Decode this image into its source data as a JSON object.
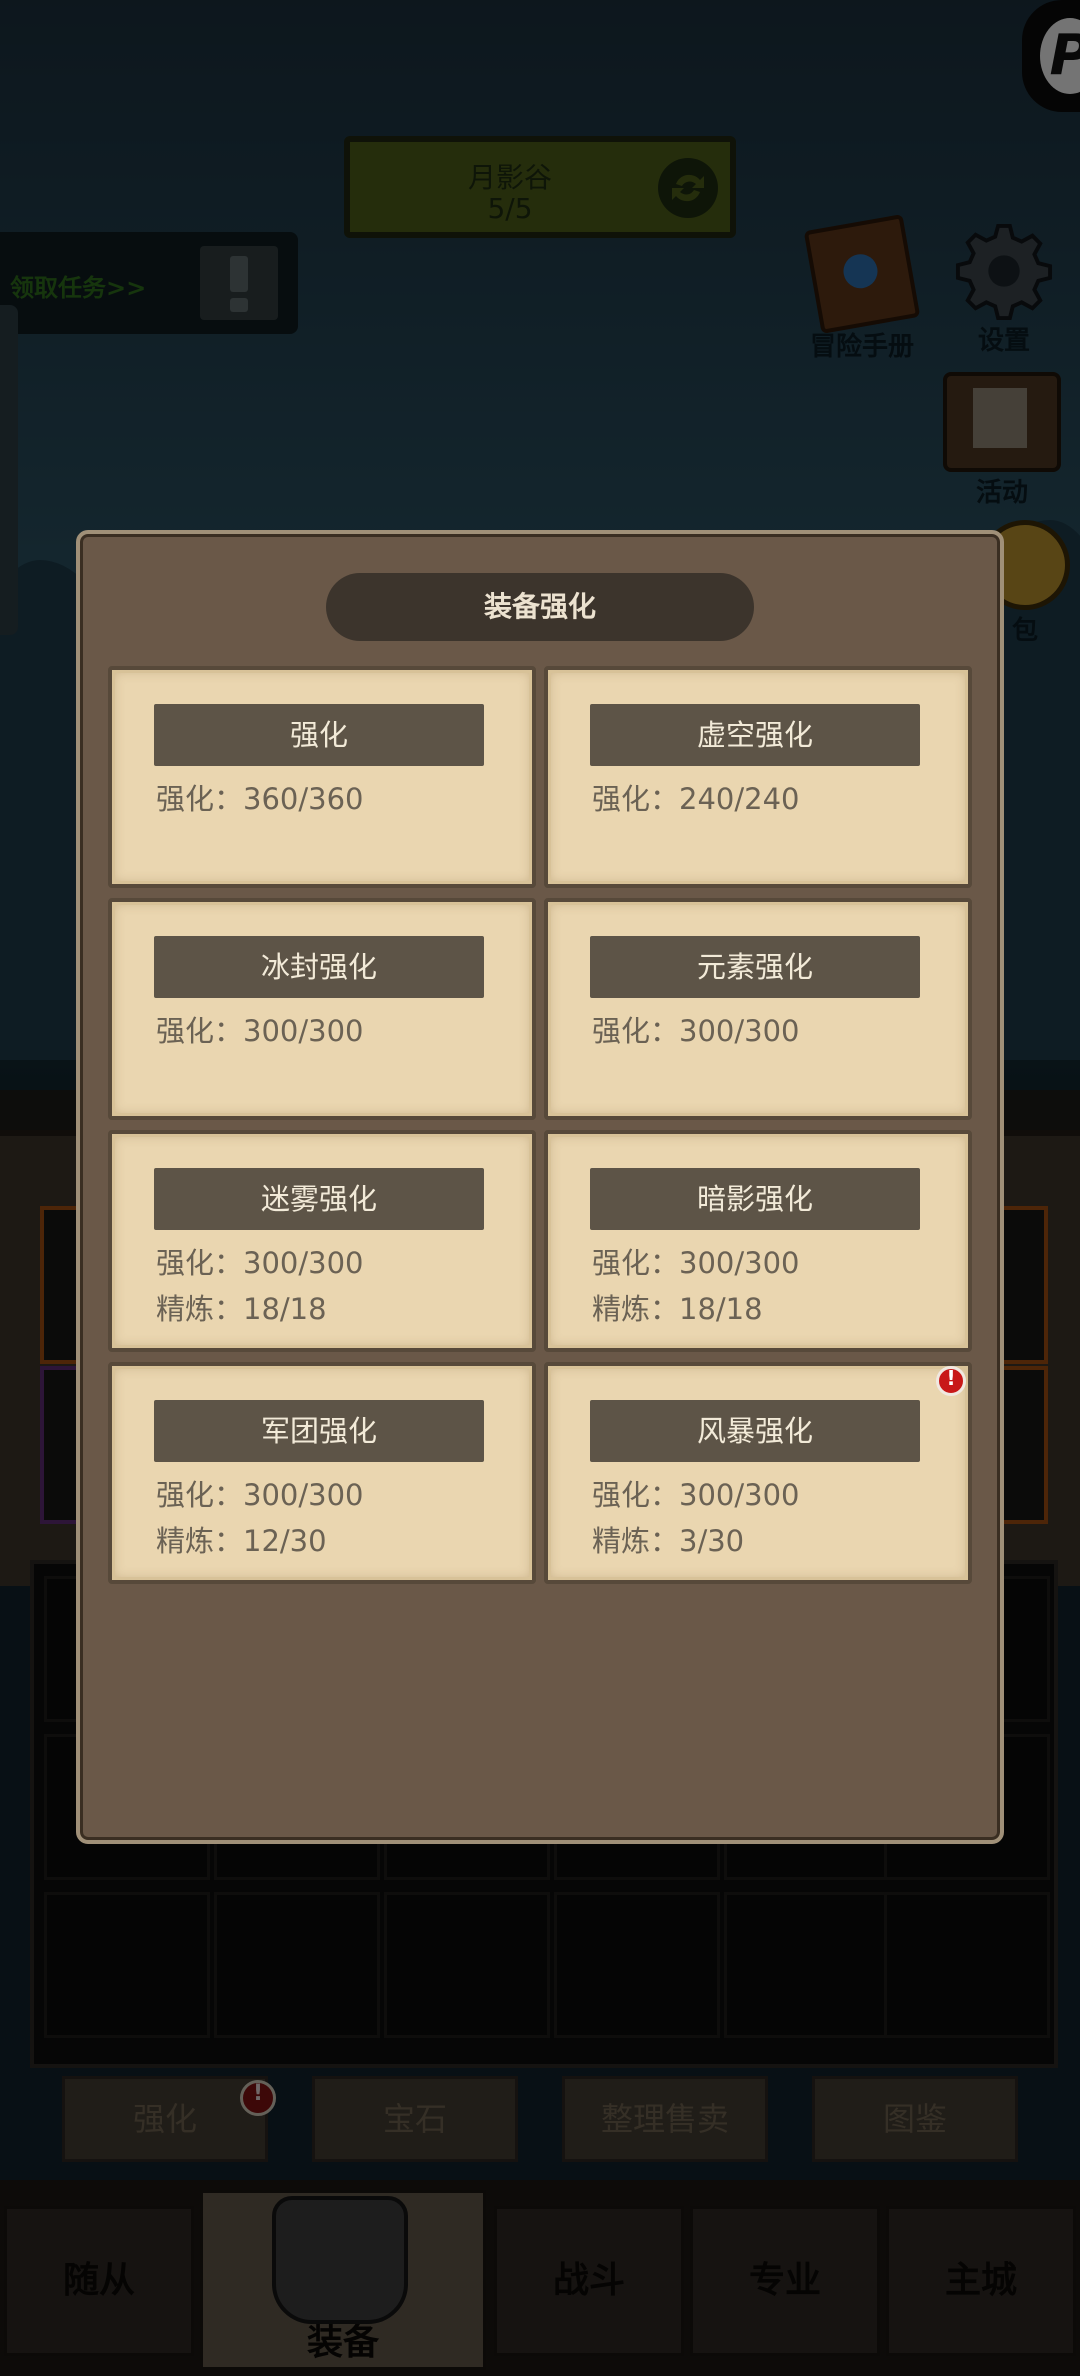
{
  "hud": {
    "scene_name": "月影谷",
    "scene_progress": "5/5",
    "quest_label": "领取任务>>",
    "menu": [
      {
        "label": "冒险手册",
        "icon": "book-icon"
      },
      {
        "label": "设置",
        "icon": "gear-icon"
      },
      {
        "label": "活动",
        "icon": "notice-board-icon"
      },
      {
        "label": "包",
        "icon": "coin-bag-icon"
      }
    ]
  },
  "modal": {
    "title": "装备强化",
    "cards": [
      {
        "name": "强化",
        "line1": "强化：360/360",
        "line2": ""
      },
      {
        "name": "虚空强化",
        "line1": "强化：240/240",
        "line2": ""
      },
      {
        "name": "冰封强化",
        "line1": "强化：300/300",
        "line2": ""
      },
      {
        "name": "元素强化",
        "line1": "强化：300/300",
        "line2": ""
      },
      {
        "name": "迷雾强化",
        "line1": "强化：300/300",
        "line2": "精炼：18/18"
      },
      {
        "name": "暗影强化",
        "line1": "强化：300/300",
        "line2": "精炼：18/18"
      },
      {
        "name": "军团强化",
        "line1": "强化：300/300",
        "line2": "精炼：12/30"
      },
      {
        "name": "风暴强化",
        "line1": "强化：300/300",
        "line2": "精炼：3/30",
        "has_alert": true
      }
    ]
  },
  "subtabs": [
    "强化",
    "宝石",
    "整理售卖",
    "图鉴"
  ],
  "navtabs": [
    "随从",
    "装备",
    "战斗",
    "专业",
    "主城"
  ],
  "colors": {
    "modal_bg": "#6a5848",
    "card_bg": "#ead6b0",
    "card_header": "#5d5447",
    "alert": "#c81818"
  }
}
